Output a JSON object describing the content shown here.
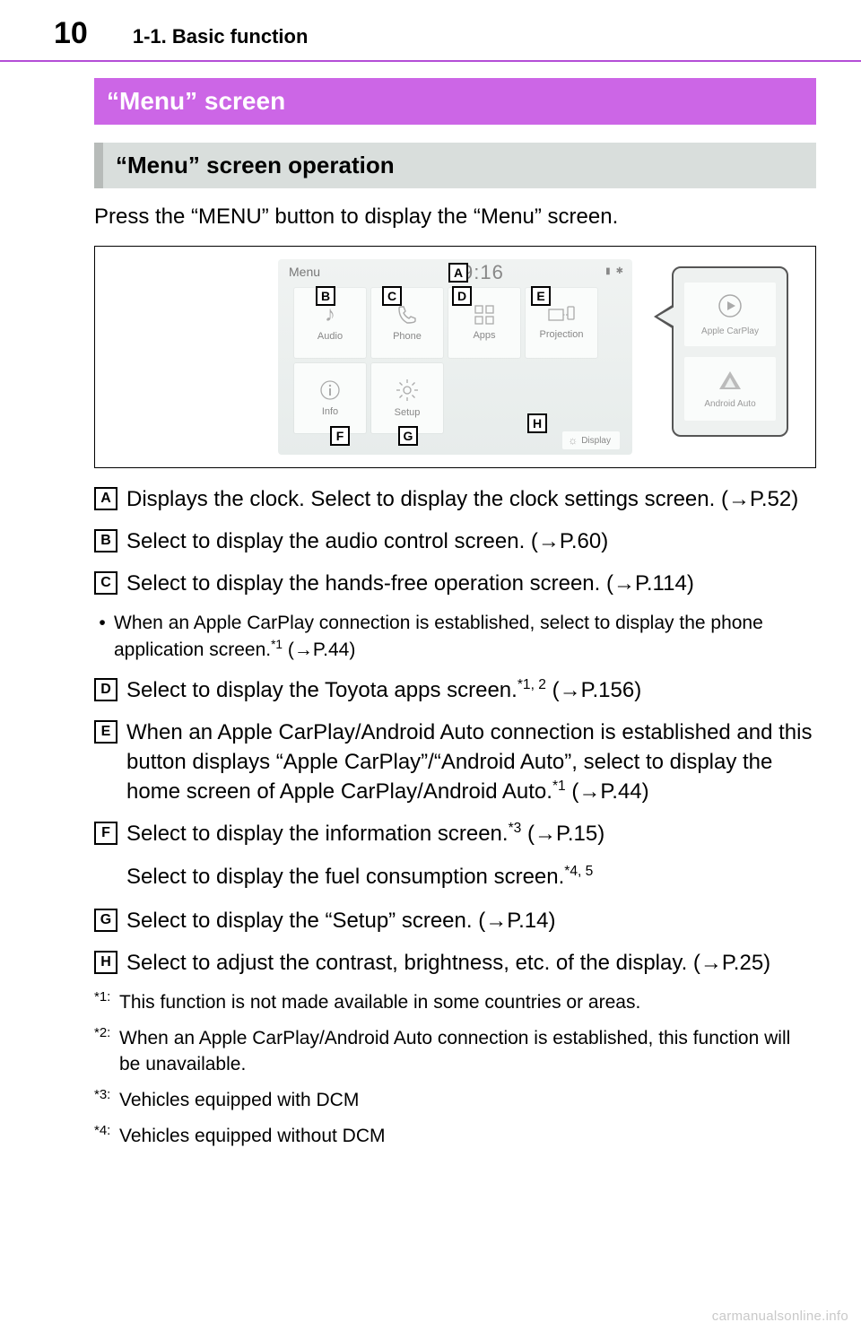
{
  "header": {
    "page_number": "10",
    "chapter": "1-1. Basic function"
  },
  "title": "“Menu” screen",
  "section": "“Menu” screen operation",
  "intro": "Press the “MENU” button to display the “Menu” screen.",
  "figure": {
    "menu_label": "Menu",
    "clock": "9:16",
    "tiles": {
      "audio": "Audio",
      "phone": "Phone",
      "apps": "Apps",
      "projection": "Projection",
      "info": "Info",
      "setup": "Setup"
    },
    "display_btn": "Display",
    "callout": {
      "carplay": "Apple CarPlay",
      "android": "Android Auto"
    },
    "markers": {
      "A": "A",
      "B": "B",
      "C": "C",
      "D": "D",
      "E": "E",
      "F": "F",
      "G": "G",
      "H": "H"
    }
  },
  "items": {
    "A": {
      "label": "A",
      "text": "Displays the clock. Select to display the clock settings screen. (→P.52)"
    },
    "B": {
      "label": "B",
      "text": "Select to display the audio control screen. (→P.60)"
    },
    "C": {
      "label": "C",
      "text": "Select to display the hands-free operation screen. (→P.114)"
    },
    "C_sub": "When an Apple CarPlay connection is established, select to display the phone application screen.",
    "C_sub_sup": "*1",
    "C_sub_tail": " (→P.44)",
    "D": {
      "label": "D",
      "pre": "Select to display the Toyota apps screen.",
      "sup": "*1, 2",
      "post": " (→P.156)"
    },
    "E": {
      "label": "E",
      "pre": "When an Apple CarPlay/Android Auto connection is established and this button displays “Apple CarPlay”/“Android Auto”, select to display the home screen of Apple CarPlay/Android Auto.",
      "sup": "*1",
      "post": " (→P.44)"
    },
    "F": {
      "label": "F",
      "pre": "Select to display the information screen.",
      "sup": "*3",
      "post": " (→P.15)"
    },
    "F2": {
      "pre": "Select to display the fuel consumption screen.",
      "sup": "*4, 5"
    },
    "G": {
      "label": "G",
      "text": "Select to display the “Setup” screen. (→P.14)"
    },
    "H": {
      "label": "H",
      "text": "Select to adjust the contrast, brightness, etc. of the display. (→P.25)"
    }
  },
  "footnotes": {
    "1": {
      "mark": "*1:",
      "text": "This function is not made available in some countries or areas."
    },
    "2": {
      "mark": "*2:",
      "text": "When an Apple CarPlay/Android Auto connection is established, this function will be unavailable."
    },
    "3": {
      "mark": "*3:",
      "text": "Vehicles equipped with DCM"
    },
    "4": {
      "mark": "*4:",
      "text": "Vehicles equipped without DCM"
    }
  },
  "watermark": "carmanualsonline.info"
}
